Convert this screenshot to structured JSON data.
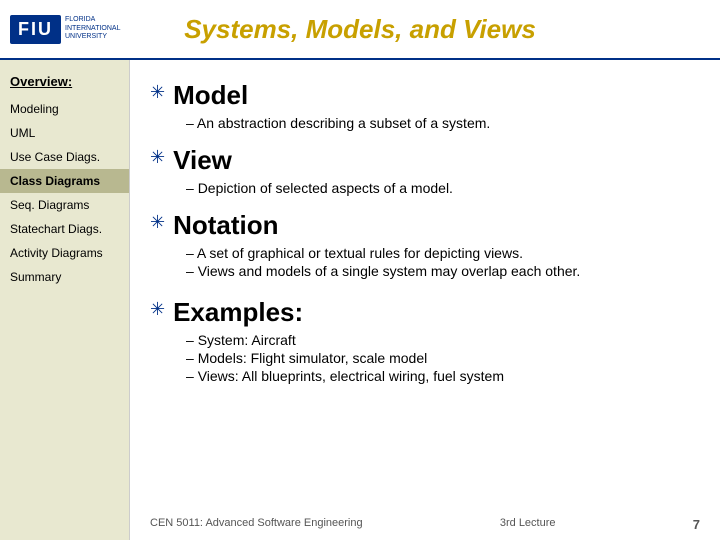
{
  "header": {
    "title": "Systems, Models, and Views",
    "logo_text": "FIU",
    "logo_sub": "FLORIDA INTERNATIONAL UNIVERSITY"
  },
  "sidebar": {
    "overview_label": "Overview:",
    "items": [
      {
        "id": "modeling",
        "label": "Modeling",
        "active": false
      },
      {
        "id": "uml",
        "label": "UML",
        "active": false
      },
      {
        "id": "use-case-diags",
        "label": "Use Case Diags.",
        "active": false
      },
      {
        "id": "class-diagrams",
        "label": "Class Diagrams",
        "active": true
      },
      {
        "id": "seq-diagrams",
        "label": "Seq. Diagrams",
        "active": false
      },
      {
        "id": "statechart-diags",
        "label": "Statechart Diags.",
        "active": false
      },
      {
        "id": "activity-diagrams",
        "label": "Activity Diagrams",
        "active": false
      },
      {
        "id": "summary",
        "label": "Summary",
        "active": false
      }
    ]
  },
  "content": {
    "sections": [
      {
        "id": "model",
        "title": "Model",
        "bullets": [
          "An abstraction describing a subset of a system."
        ]
      },
      {
        "id": "view",
        "title": "View",
        "bullets": [
          "Depiction of selected aspects of a model."
        ]
      },
      {
        "id": "notation",
        "title": "Notation",
        "bullets": [
          "A set of graphical or textual rules for depicting views.",
          "Views and models of a single system may overlap each other."
        ]
      }
    ],
    "examples": {
      "title": "Examples:",
      "bullets": [
        "System: Aircraft",
        "Models: Flight simulator, scale model",
        "Views: All blueprints, electrical wiring, fuel system"
      ]
    },
    "footer": {
      "course": "CEN 5011: Advanced Software Engineering",
      "lecture": "3rd Lecture",
      "page": "7"
    }
  }
}
